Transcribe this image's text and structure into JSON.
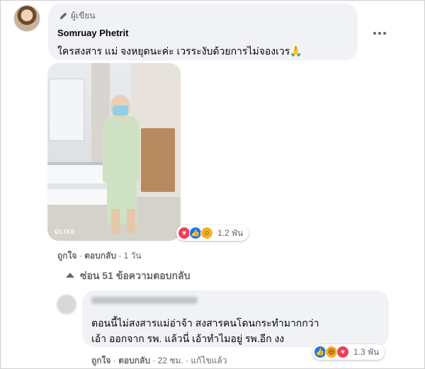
{
  "comment": {
    "author_badge": "ผู้เขียน",
    "author_name": "Somruay Phetrit",
    "text": "ใครสงสาร แม่ จงหยุดนะค่ะ เวรระงับด้วยการไม่จองเวร🙏",
    "photo_watermark": "OLIKE",
    "reaction_count": "1.2 พัน",
    "reactions": [
      "love",
      "like",
      "care"
    ],
    "actions": {
      "like": "ถูกใจ",
      "reply": "ตอบกลับ",
      "time": "1 วัน",
      "sep": "·"
    }
  },
  "replies_toggle": {
    "label": "ซ่อน 51 ข้อความตอบกลับ"
  },
  "reply": {
    "line1": "ตอนนี้ไม่สงสารแม่อ่าจ้า สงสารคนโดนกระทำมากกว่า",
    "line2": "เอ้า ออกจาก รพ. แล้วนี่ เอ้าทำไมอยู่ รพ.อีก งง",
    "reaction_count": "1.3 พัน",
    "reactions": [
      "like",
      "haha",
      "love"
    ],
    "actions": {
      "like": "ถูกใจ",
      "reply": "ตอบกลับ",
      "time": "22 ชม.",
      "edited": "แก้ไขแล้ว",
      "sep": "·"
    }
  },
  "colors": {
    "bubble": "#f0f2f5",
    "secondary_text": "#65676b",
    "like_blue": "#1877f2",
    "love_red": "#f33e58",
    "haha_yellow": "#f7b125"
  }
}
